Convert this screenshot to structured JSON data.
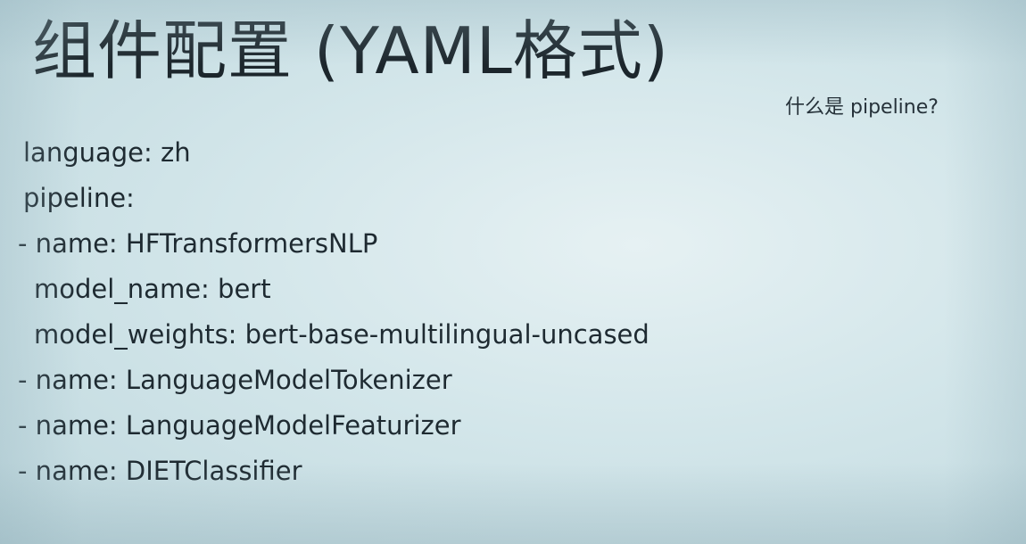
{
  "slide": {
    "title": "组件配置 (YAML格式)",
    "side_question": "什么是 pipeline?",
    "yaml_lines": [
      {
        "text": "language: zh",
        "style": "plain"
      },
      {
        "text": "pipeline:",
        "style": "plain"
      },
      {
        "text": "- name: HFTransformersNLP",
        "style": "dash"
      },
      {
        "text": "model_name: bert",
        "style": "indent"
      },
      {
        "text": "model_weights: bert-base-multilingual-uncased",
        "style": "indent"
      },
      {
        "text": "- name: LanguageModelTokenizer",
        "style": "dash"
      },
      {
        "text": "- name: LanguageModelFeaturizer",
        "style": "dash"
      },
      {
        "text": "- name: DIETClassifier",
        "style": "dash"
      }
    ]
  }
}
